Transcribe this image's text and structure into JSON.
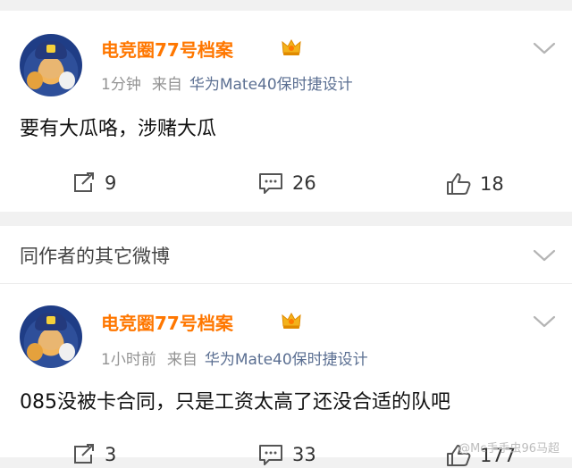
{
  "posts": [
    {
      "username": "电竞圈77号档案",
      "time": "1分钟",
      "source_prefix": "来自",
      "device": "华为Mate40保时捷设计",
      "text": "要有大瓜咯，涉赌大瓜",
      "reposts": "9",
      "comments": "26",
      "likes": "18"
    },
    {
      "username": "电竞圈77号档案",
      "time": "1小时前",
      "source_prefix": "来自",
      "device": "华为Mate40保时捷设计",
      "text": "085没被卡合同，只是工资太高了还没合适的队吧",
      "reposts": "3",
      "comments": "33",
      "likes": "177"
    }
  ],
  "section": {
    "title": "同作者的其它微博"
  },
  "watermark": "@Mc手手虫96马超",
  "colors": {
    "username": "#ff7700",
    "device": "#5b6f92",
    "meta": "#939393",
    "background": "#f1f1f1"
  },
  "icons": [
    "avatar-image",
    "vip-crown-icon",
    "chevron-down-icon",
    "repost-icon",
    "comment-icon",
    "like-icon"
  ]
}
